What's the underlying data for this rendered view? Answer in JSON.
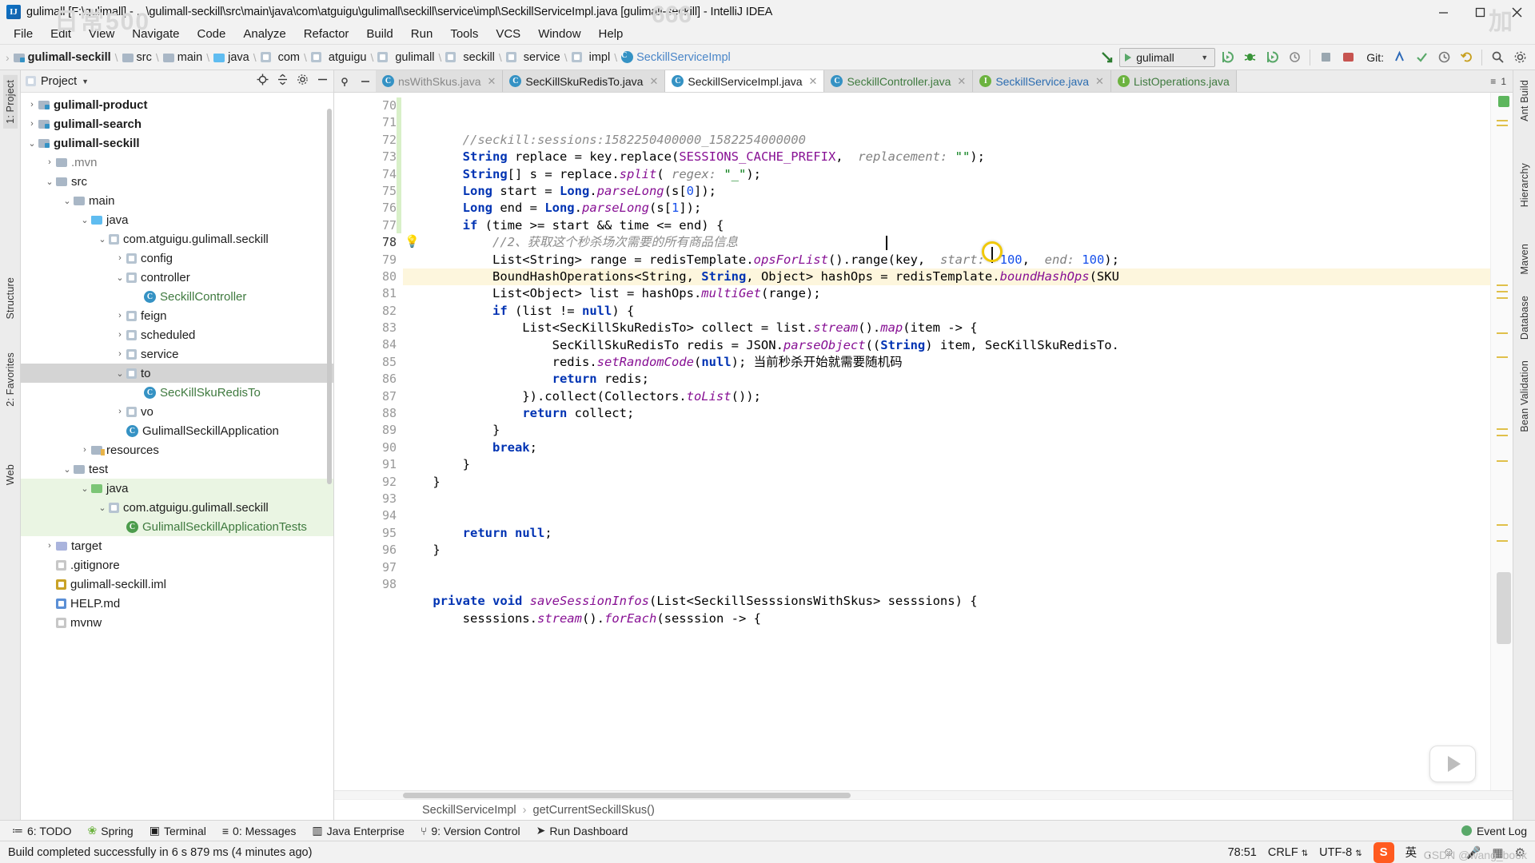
{
  "watermarks": {
    "left": "日常500",
    "middle": "666",
    "right": "加",
    "bottom": "CSDN @wang_book"
  },
  "window": {
    "title": "gulimall [F:\\gulimall] - ...\\gulimall-seckill\\src\\main\\java\\com\\atguigu\\gulimall\\seckill\\service\\impl\\SeckillServiceImpl.java [gulimall-seckill] - IntelliJ IDEA",
    "logo": "IJ",
    "minimize": "minimize-icon",
    "maximize": "maximize-icon",
    "close": "close-icon"
  },
  "menubar": [
    {
      "label": "File",
      "accel": "F"
    },
    {
      "label": "Edit",
      "accel": "E"
    },
    {
      "label": "View",
      "accel": "V"
    },
    {
      "label": "Navigate",
      "accel": "N"
    },
    {
      "label": "Code",
      "accel": "C"
    },
    {
      "label": "Analyze",
      "accel": "z"
    },
    {
      "label": "Refactor",
      "accel": "R"
    },
    {
      "label": "Build",
      "accel": "B"
    },
    {
      "label": "Run",
      "accel": "u"
    },
    {
      "label": "Tools",
      "accel": "T"
    },
    {
      "label": "VCS",
      "accel": "S"
    },
    {
      "label": "Window",
      "accel": "W"
    },
    {
      "label": "Help",
      "accel": "H"
    }
  ],
  "breadcrumb": [
    {
      "label": "gulimall-seckill",
      "icon": "module-icon",
      "bold": true
    },
    {
      "label": "src",
      "icon": "folder-icon",
      "bold": false
    },
    {
      "label": "main",
      "icon": "folder-icon",
      "bold": false
    },
    {
      "label": "java",
      "icon": "source-folder-icon",
      "bold": false
    },
    {
      "label": "com",
      "icon": "package-icon",
      "bold": false
    },
    {
      "label": "atguigu",
      "icon": "package-icon",
      "bold": false
    },
    {
      "label": "gulimall",
      "icon": "package-icon",
      "bold": false
    },
    {
      "label": "seckill",
      "icon": "package-icon",
      "bold": false
    },
    {
      "label": "service",
      "icon": "package-icon",
      "bold": false
    },
    {
      "label": "impl",
      "icon": "package-icon",
      "bold": false
    },
    {
      "label": "SeckillServiceImpl",
      "icon": "class-icon",
      "bold": false
    }
  ],
  "toolbar": {
    "run_config": "gulimall",
    "run_icon": "run-icon",
    "dropdown_icon": "chevron-down-icon",
    "buttons": [
      "run-button",
      "debug-button",
      "run-with-coverage-button",
      "profiler-button",
      "stop-button",
      "redis-button"
    ],
    "git_label": "Git:",
    "git_buttons": [
      "update-project-icon",
      "commit-icon",
      "history-icon",
      "rollback-icon",
      "search-everywhere-icon",
      "settings-icon"
    ]
  },
  "project_panel": {
    "title": "Project",
    "locate_icon": "locate-icon",
    "collapse_icon": "collapse-all-icon",
    "settings_icon": "gear-icon",
    "hide_icon": "hide-icon",
    "tree": [
      {
        "label": "gulimall-product",
        "depth": 1,
        "arrow": "collapsed",
        "icon": "module-icon",
        "bold": true,
        "style": "normal"
      },
      {
        "label": "gulimall-search",
        "depth": 1,
        "arrow": "collapsed",
        "icon": "module-icon",
        "bold": true,
        "style": "normal"
      },
      {
        "label": "gulimall-seckill",
        "depth": 1,
        "arrow": "expanded",
        "icon": "module-icon",
        "bold": true,
        "style": "normal"
      },
      {
        "label": ".mvn",
        "depth": 2,
        "arrow": "collapsed",
        "icon": "folder-icon",
        "bold": false,
        "style": "dim"
      },
      {
        "label": "src",
        "depth": 2,
        "arrow": "expanded",
        "icon": "folder-icon",
        "bold": false,
        "style": "normal"
      },
      {
        "label": "main",
        "depth": 3,
        "arrow": "expanded",
        "icon": "folder-icon",
        "bold": false,
        "style": "normal"
      },
      {
        "label": "java",
        "depth": 4,
        "arrow": "expanded",
        "icon": "source-folder-icon",
        "bold": false,
        "style": "normal"
      },
      {
        "label": "com.atguigu.gulimall.seckill",
        "depth": 5,
        "arrow": "expanded",
        "icon": "package-icon",
        "bold": false,
        "style": "normal"
      },
      {
        "label": "config",
        "depth": 6,
        "arrow": "collapsed",
        "icon": "package-icon",
        "bold": false,
        "style": "normal"
      },
      {
        "label": "controller",
        "depth": 6,
        "arrow": "expanded",
        "icon": "package-icon",
        "bold": false,
        "style": "normal"
      },
      {
        "label": "SeckillController",
        "depth": 7,
        "arrow": "none",
        "icon": "class-icon",
        "bold": false,
        "style": "green"
      },
      {
        "label": "feign",
        "depth": 6,
        "arrow": "collapsed",
        "icon": "package-icon",
        "bold": false,
        "style": "normal"
      },
      {
        "label": "scheduled",
        "depth": 6,
        "arrow": "collapsed",
        "icon": "package-icon",
        "bold": false,
        "style": "normal"
      },
      {
        "label": "service",
        "depth": 6,
        "arrow": "collapsed",
        "icon": "package-icon",
        "bold": false,
        "style": "normal"
      },
      {
        "label": "to",
        "depth": 6,
        "arrow": "expanded",
        "icon": "package-icon",
        "bold": false,
        "style": "selected"
      },
      {
        "label": "SecKillSkuRedisTo",
        "depth": 7,
        "arrow": "none",
        "icon": "class-icon",
        "bold": false,
        "style": "green"
      },
      {
        "label": "vo",
        "depth": 6,
        "arrow": "collapsed",
        "icon": "package-icon",
        "bold": false,
        "style": "normal"
      },
      {
        "label": "GulimallSeckillApplication",
        "depth": 6,
        "arrow": "none",
        "icon": "spring-class-icon",
        "bold": false,
        "style": "normal"
      },
      {
        "label": "resources",
        "depth": 4,
        "arrow": "collapsed",
        "icon": "resources-folder-icon",
        "bold": false,
        "style": "normal"
      },
      {
        "label": "test",
        "depth": 3,
        "arrow": "expanded",
        "icon": "folder-icon",
        "bold": false,
        "style": "normal"
      },
      {
        "label": "java",
        "depth": 4,
        "arrow": "expanded",
        "icon": "test-source-folder-icon",
        "bold": false,
        "style": "greenbg"
      },
      {
        "label": "com.atguigu.gulimall.seckill",
        "depth": 5,
        "arrow": "expanded",
        "icon": "package-icon",
        "bold": false,
        "style": "greenbg"
      },
      {
        "label": "GulimallSeckillApplicationTests",
        "depth": 6,
        "arrow": "none",
        "icon": "test-class-icon",
        "bold": false,
        "style": "greenbg-green"
      },
      {
        "label": "target",
        "depth": 2,
        "arrow": "collapsed",
        "icon": "excluded-folder-icon",
        "bold": false,
        "style": "normal"
      },
      {
        "label": ".gitignore",
        "depth": 2,
        "arrow": "none",
        "icon": "file-icon",
        "bold": false,
        "style": "normal"
      },
      {
        "label": "gulimall-seckill.iml",
        "depth": 2,
        "arrow": "none",
        "icon": "iml-icon",
        "bold": false,
        "style": "normal"
      },
      {
        "label": "HELP.md",
        "depth": 2,
        "arrow": "none",
        "icon": "md-icon",
        "bold": false,
        "style": "normal"
      },
      {
        "label": "mvnw",
        "depth": 2,
        "arrow": "none",
        "icon": "file-icon",
        "bold": false,
        "style": "normal"
      }
    ]
  },
  "left_rail": [
    {
      "label": "1: Project",
      "active": true
    },
    {
      "label": "Structure",
      "active": false
    },
    {
      "label": "2: Favorites",
      "active": false
    },
    {
      "label": "Web",
      "active": false
    }
  ],
  "right_rail": [
    {
      "label": "Ant Build"
    },
    {
      "label": "Hierarchy"
    },
    {
      "label": "Maven"
    },
    {
      "label": "Database"
    },
    {
      "label": "Bean Validation"
    }
  ],
  "editor_tabs": [
    {
      "label": "nsWithSkus.java",
      "icon": "class-icon",
      "active": false,
      "color": "fade"
    },
    {
      "label": "SecKillSkuRedisTo.java",
      "icon": "class-icon",
      "active": false,
      "color": "normal"
    },
    {
      "label": "SeckillServiceImpl.java",
      "icon": "class-icon",
      "active": true,
      "color": "normal"
    },
    {
      "label": "SeckillController.java",
      "icon": "class-icon",
      "active": false,
      "color": "normal"
    },
    {
      "label": "SeckillService.java",
      "icon": "interface-icon",
      "active": false,
      "color": "blue"
    },
    {
      "label": "ListOperations.java",
      "icon": "interface-icon",
      "active": false,
      "color": "normal"
    }
  ],
  "code": {
    "first_line": 70,
    "highlight_line": 78,
    "lines": [
      {
        "n": 70,
        "text": "        //seckill:sessions:1582250400000_1582254000000"
      },
      {
        "n": 71,
        "text": "        String replace = key.replace(SESSIONS_CACHE_PREFIX,  replacement: \"\");"
      },
      {
        "n": 72,
        "text": "        String[] s = replace.split( regex: \"_\");"
      },
      {
        "n": 73,
        "text": "        Long start = Long.parseLong(s[0]);"
      },
      {
        "n": 74,
        "text": "        Long end = Long.parseLong(s[1]);"
      },
      {
        "n": 75,
        "text": "        if (time >= start && time <= end) {"
      },
      {
        "n": 76,
        "text": "            //2、获取这个秒杀场次需要的所有商品信息"
      },
      {
        "n": 77,
        "text": "            List<String> range = redisTemplate.opsForList().range(key,  start: -100,  end: 100);"
      },
      {
        "n": 78,
        "text": "            BoundHashOperations<String, String, Object> hashOps = redisTemplate.boundHashOps(SKU"
      },
      {
        "n": 79,
        "text": "            List<Object> list = hashOps.multiGet(range);"
      },
      {
        "n": 80,
        "text": "            if (list != null) {"
      },
      {
        "n": 81,
        "text": "                List<SecKillSkuRedisTo> collect = list.stream().map(item -> {"
      },
      {
        "n": 82,
        "text": "                    SecKillSkuRedisTo redis = JSON.parseObject((String) item, SecKillSkuRedisTo."
      },
      {
        "n": 83,
        "text": "                    redis.setRandomCode(null); 当前秒杀开始就需要随机码"
      },
      {
        "n": 84,
        "text": "                    return redis;"
      },
      {
        "n": 85,
        "text": "                }).collect(Collectors.toList());"
      },
      {
        "n": 86,
        "text": "                return collect;"
      },
      {
        "n": 87,
        "text": "            }"
      },
      {
        "n": 88,
        "text": "            break;"
      },
      {
        "n": 89,
        "text": "        }"
      },
      {
        "n": 90,
        "text": "    }"
      },
      {
        "n": 91,
        "text": ""
      },
      {
        "n": 92,
        "text": ""
      },
      {
        "n": 93,
        "text": "        return null;"
      },
      {
        "n": 94,
        "text": "    }"
      },
      {
        "n": 95,
        "text": ""
      },
      {
        "n": 96,
        "text": ""
      },
      {
        "n": 97,
        "text": "    private void saveSessionInfos(List<SeckillSesssionsWithSkus> sesssions) {"
      },
      {
        "n": 98,
        "text": "        sesssions.stream().forEach(sesssion -> {"
      }
    ]
  },
  "editor_breadcrumb": [
    "SeckillServiceImpl",
    "getCurrentSeckillSkus()"
  ],
  "bottom_bar": {
    "items": [
      {
        "label": "6: TODO",
        "icon": "todo-icon"
      },
      {
        "label": "Spring",
        "icon": "spring-icon"
      },
      {
        "label": "Terminal",
        "icon": "terminal-icon"
      },
      {
        "label": "0: Messages",
        "icon": "messages-icon"
      },
      {
        "label": "Java Enterprise",
        "icon": "java-enterprise-icon"
      },
      {
        "label": "9: Version Control",
        "icon": "version-control-icon"
      },
      {
        "label": "Run Dashboard",
        "icon": "run-dashboard-icon"
      }
    ],
    "event_log": "Event Log"
  },
  "statusbar": {
    "message": "Build completed successfully in 6 s 879 ms (4 minutes ago)",
    "caret_position": "78:51",
    "line_separator": "CRLF",
    "encoding": "UTF-8",
    "ime": "英",
    "icons": [
      "sogou-icon",
      "ime-icon",
      "lock-icon",
      "notification-icon",
      "mic-icon",
      "hierarchy-icon",
      "gear-icon"
    ]
  },
  "colors": {
    "accent": "#3592c4",
    "keyword": "#0033b3",
    "string": "#067d17",
    "number": "#1750eb",
    "comment": "#8c8c8c",
    "field": "#871094",
    "green_class": "#3f7a3f",
    "highlight_line": "#fdf6dd",
    "selection": "#c3e7c3"
  }
}
